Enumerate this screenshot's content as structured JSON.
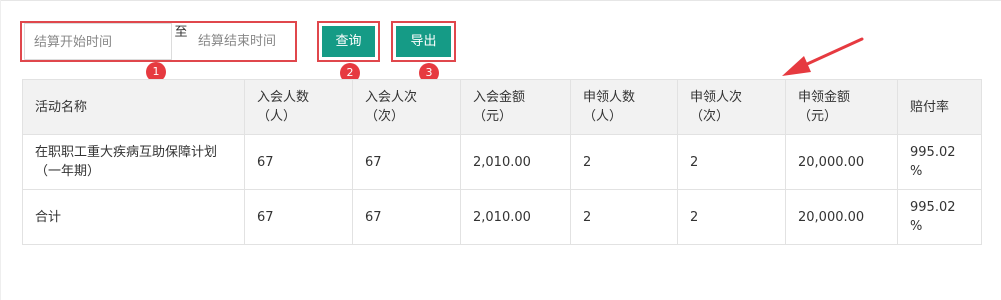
{
  "filter": {
    "start_placeholder": "结算开始时间",
    "separator": "至",
    "end_placeholder": "结算结束时间"
  },
  "buttons": {
    "query_label": "查询",
    "export_label": "导出"
  },
  "markers": [
    "1",
    "2",
    "3"
  ],
  "colors": {
    "accent_button": "#159b86",
    "highlight_border": "#e0474c",
    "marker": "#e63a40"
  },
  "table": {
    "headers": [
      [
        "活动名称"
      ],
      [
        "入会人数",
        "（人）"
      ],
      [
        "入会人次",
        "（次）"
      ],
      [
        "入会金额",
        "（元）"
      ],
      [
        "申领人数",
        "（人）"
      ],
      [
        "申领人次",
        "（次）"
      ],
      [
        "申领金额",
        "（元）"
      ],
      [
        "赔付率"
      ]
    ],
    "rows": [
      [
        [
          "在职职工重大疾病互助保障计划",
          "（一年期）"
        ],
        [
          "67"
        ],
        [
          "67"
        ],
        [
          "2,010.00"
        ],
        [
          "2"
        ],
        [
          "2"
        ],
        [
          "20,000.00"
        ],
        [
          "995.02",
          "%"
        ]
      ],
      [
        [
          "合计"
        ],
        [
          "67"
        ],
        [
          "67"
        ],
        [
          "2,010.00"
        ],
        [
          "2"
        ],
        [
          "2"
        ],
        [
          "20,000.00"
        ],
        [
          "995.02",
          "%"
        ]
      ]
    ]
  }
}
